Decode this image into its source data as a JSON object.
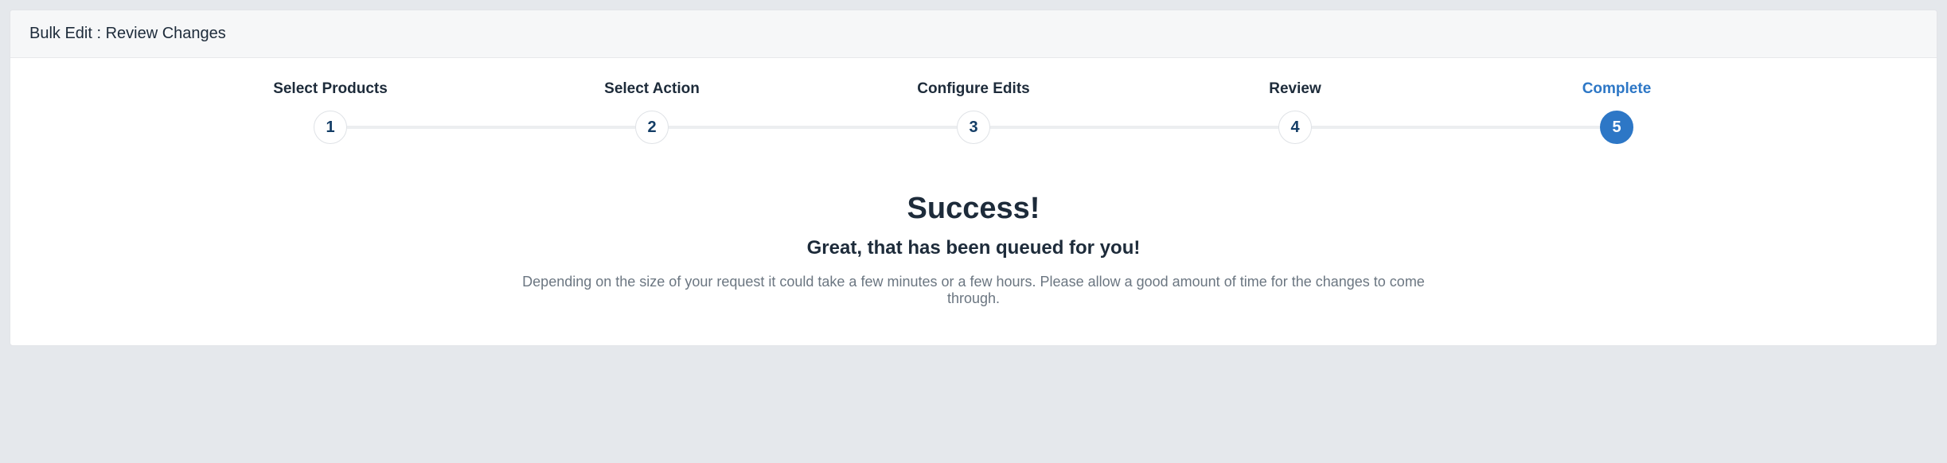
{
  "header": {
    "title": "Bulk Edit : Review Changes"
  },
  "stepper": {
    "steps": [
      {
        "label": "Select Products",
        "number": "1",
        "active": false
      },
      {
        "label": "Select Action",
        "number": "2",
        "active": false
      },
      {
        "label": "Configure Edits",
        "number": "3",
        "active": false
      },
      {
        "label": "Review",
        "number": "4",
        "active": false
      },
      {
        "label": "Complete",
        "number": "5",
        "active": true
      }
    ]
  },
  "content": {
    "title": "Success!",
    "subtitle": "Great, that has been queued for you!",
    "description": "Depending on the size of your request it could take a few minutes or a few hours. Please allow a good amount of time for the changes to come through."
  }
}
